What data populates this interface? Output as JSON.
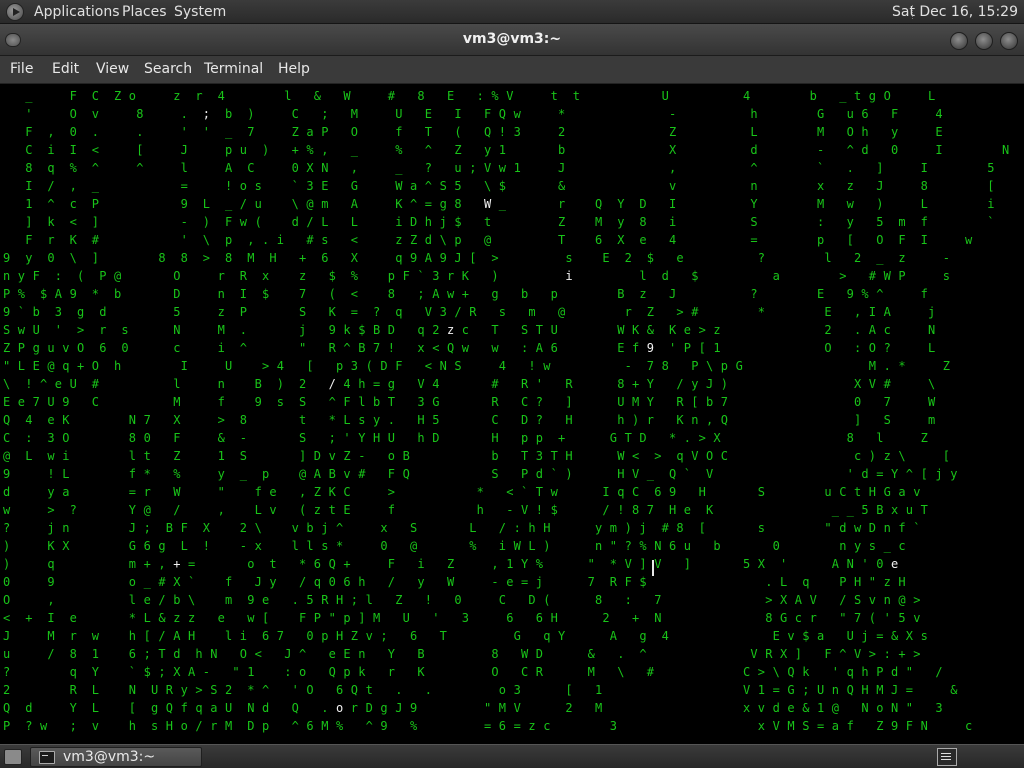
{
  "top_panel": {
    "menus": [
      "Applications",
      "Places",
      "System"
    ],
    "clock": "Sat Dec 16, 15:29"
  },
  "window": {
    "title": "vm3@vm3:~"
  },
  "menubar": {
    "items": [
      "File",
      "Edit",
      "View",
      "Search",
      "Terminal",
      "Help"
    ]
  },
  "terminal": {
    "program": "cmatrix",
    "rows": [
      "   _     F  C  Z o     z  r  4        l   &   W     #   8   E   : % V     t  t           U          4        b   _ t g O     L",
      "   '     O  v     8     .  ;  b  )     C   ;   M     U   E   I   F Q w     *              -          h        G   u 6   F     4",
      "   F  ,  0  .     .     '  '  _  7     Z a P   O     f   T   (   Q ! 3     2              Z          L        M   O h   y     E",
      "   C  i  I  <     [     J     p u  )   + % ,   _     %   ^   Z   y 1       b              X          d        -   ^ d   0     I        N",
      "   8  q  %  ^     ^     l     A  C     0 X N   ,     _   ?   u ; V w 1     J              ,          ^        `   .   ]     I        5",
      "   I  /  ,  _           =     ! o s    ` 3 E   G     W a ^ S 5   \\ $       &              v          n        x   z   J     8        [",
      "   1  ^  c  P           9  L  _ / u    \\ @ m   A     K ^ = g 8   W _       r    Q  Y  D   I          Y        M   w   )     L        i",
      "   ]  k  <  ]           -  )  F w (    d / L   L     i D h j $   t         Z    M  y  8   i          S        :   y   5  m  f        `",
      "   F  r  K  #           '  \\  p  , . i   # s   <     z Z d \\ p   @         T    6  X  e   4          =        p   [   O  F  I     w",
      "9  y  0  \\  ]        8  8  >  8  M  H   +  6   X     q 9 A 9 J [  >         s    E  2  $   e          ?        l   2  _  z     -",
      "n y F  :  (  P @       O     r  R  x    z   $  %    p F ` 3 r K   )         i         l  d   $          a        >   # W P     s",
      "P %  $ A 9  *  b       D     n  I  $    7   (  <    8   ; A w +   g   b   p        B  z   J          ?        E   9 % ^     f",
      "9 ` b  3  g  d         5     z  P       S   K  =  ?  q   V 3 / R   s   m   @        r  Z   > #        *        E   , I A     j",
      "S w U  '  >  r  s      N     M  .       j   9 k $ B D   q 2 z c   T   S T U        W K &  K e > z              2   . A c     N",
      "Z P g u v O  6  0      c     i  ^       \"   R ^ B 7 !   x < Q w   w   : A 6        E f 9  ' P [ 1              O   : O ?     L",
      "\" L E @ q + O  h        I     U    > 4   [   p 3 ( D F   < N S     4   ! w          -  7 8   P \\ p G                 M . *     Z",
      "\\  ! ^ e U  #          l     n    B  )  2   / 4 h = g   V 4       #   R '   R      8 + Y   / y J )                 X V #     \\",
      "E e 7 U 9   C          M     f    9  s  S   ^ F l b T   3 G       R   C ?   ]      U M Y   R [ b 7                 0   7     W",
      "Q  4  e K        N 7   X     >  8       t   * L s y .   H 5       C   D ?   H      h ) r   K n , Q                 ]   S     m",
      "C  :  3 O        8 0   F     &  -       S   ; ' Y H U   h D       H   p p  +      G T D   * . > X                 8   l     Z",
      "@  L  w i        l t   Z     1  S       ] D v Z -   o B           b   T 3 T H      W <  >  q V O C                 c ) z \\     [",
      "9     ! L        f *   %     y  _  p    @ A B v #   F Q           S   P d ` )      H V _  Q `  V                  ' d = Y ^ [ j y",
      "d     y a        = r   W     \"    f e   , Z K C     >           *   < ` T w      I q C  6 9   H       S        u C t H G a v",
      "w     >  ?       Y @   /     ,    L v   ( z t E     f           h   - V ! $      / ! 8 7  H e  K                _ _ 5 B x u T",
      "?     j n        J ;  B F  X    2 \\    v b j ^     x   S       L   / : h H      y m ) j  # 8  [       s        \" d w D n f `",
      ")     K X        G 6 g  L  !    - x    l l s *     0   @       %   i W L )      n \" ? % N 6 u   b       0        n y s _ c",
      ")     q          m + , + =       o  t   * 6 Q +     F   i   Z     , 1 Y %      \"  * V ] V   ]       5 X  '      A N ' 0 e",
      "0     9          o _ # X `    f   J y   / q 0 6 h   /   y   W     - e = j      7  R F $                . L  q    P H \" z H",
      "O     ,          l e / b \\    m  9 e   . 5 R H ; l   Z   !   0     C   D (      8   :   7              > X A V   / S v n @ >",
      "<  +  I  e       * L & z z   e   w [    F P \" p ] M   U   '   3     6   6 H      2   +  N              8 G c r   \" 7 ( ' 5 v",
      "J     M  r  w    h [ / A H    l i  6 7   0 p H Z v ;   6   T         G   q Y      A   g  4              E v $ a   U j = & X s",
      "u     /  8  1    6 ; T d  h N   O <   J ^   e E n   Y   B         8   W D      &   .  ^              V R X ]   F ^ V > : + >",
      "?        q  Y    ` $ ; X A -   \" 1    : o   Q p k   r   K         O   C R      M   \\   #            C > \\ Q k   ' q h P d \"   /",
      "2        R  L    N  U R y > S 2  * ^   ' O   6 Q t   .   .         o 3      [   1                   V 1 = G ; U n Q H M J =     &",
      "Q  d     Y  L    [  g Q f q a U  N d   Q   . o r D g J 9         \" M V      2   M                   x v d e & 1 @   N o N \"   3",
      "P  ? w   ;  v    h  s H o / r M  D p   ^ 6 M %   ^ 9   %         = 6 = z c        3                   x V M S = a f   Z 9 F N     c"
    ],
    "highlights": [
      "Z",
      "t",
      "g",
      "3",
      "p",
      "d",
      "W",
      "d",
      "6",
      "E",
      "2",
      "P",
      "F",
      "D",
      "6",
      "O",
      "8",
      "8",
      "L",
      "O",
      "w",
      "S",
      "V",
      "#",
      "E",
      "9",
      "C",
      "L",
      "S",
      "V",
      "O",
      "C",
      "p",
      "#",
      "Q",
      "f",
      "X",
      "%",
      "?",
      "]",
      "\"",
      "V",
      "e",
      "j",
      "F",
      "$",
      "[",
      "U",
      "O",
      "#",
      "N",
      "2"
    ]
  },
  "taskbar": {
    "task_label": "vm3@vm3:~"
  }
}
